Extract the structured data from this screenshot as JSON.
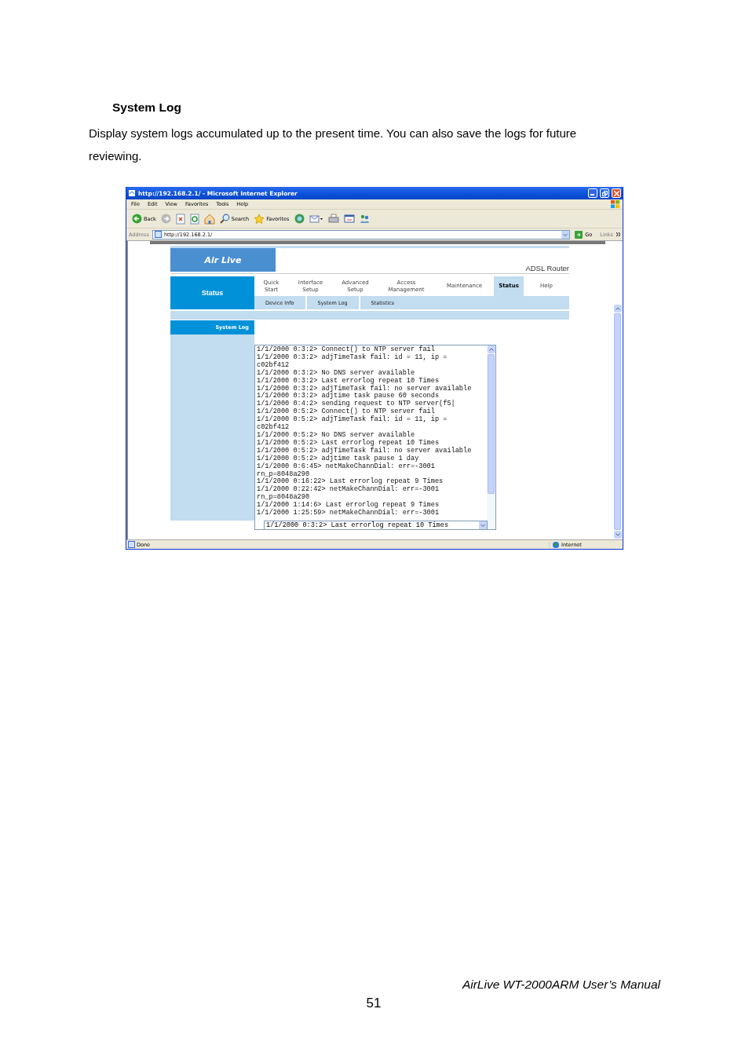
{
  "document": {
    "heading": "System Log",
    "paragraph": "Display system logs accumulated up to the present time. You can also save the logs for future reviewing.",
    "footer": "AirLive WT-2000ARM User’s Manual",
    "page_number": "51"
  },
  "browser": {
    "title": "http://192.168.2.1/ - Microsoft Internet Explorer",
    "menu": [
      "File",
      "Edit",
      "View",
      "Favorites",
      "Tools",
      "Help"
    ],
    "toolbar": [
      {
        "kind": "back",
        "label": "Back"
      },
      {
        "kind": "forward"
      },
      {
        "kind": "stop"
      },
      {
        "kind": "refresh"
      },
      {
        "kind": "home"
      },
      {
        "kind": "search",
        "label": "Search"
      },
      {
        "kind": "favorites",
        "label": "Favorites"
      },
      {
        "kind": "media"
      },
      {
        "kind": "mail"
      },
      {
        "kind": "print"
      },
      {
        "kind": "edit"
      },
      {
        "kind": "messenger"
      }
    ],
    "address": {
      "label": "Address",
      "value": "http://192.168.2.1/",
      "go": "Go",
      "links": "Links"
    },
    "status": {
      "text": "Done",
      "zone": "Internet"
    }
  },
  "router": {
    "logo": "Air Live",
    "product": "ADSL Router",
    "section": "Status",
    "nav": [
      {
        "lines": [
          "Quick",
          "Start"
        ],
        "selected": false
      },
      {
        "lines": [
          "Interface",
          "Setup"
        ],
        "selected": false
      },
      {
        "lines": [
          "Advanced",
          "Setup"
        ],
        "selected": false
      },
      {
        "lines": [
          "Access",
          "Management"
        ],
        "selected": false
      },
      {
        "lines": [
          "Maintenance"
        ],
        "selected": false
      },
      {
        "lines": [
          "Status"
        ],
        "selected": true
      },
      {
        "lines": [
          "Help"
        ],
        "selected": false
      }
    ],
    "subnav": [
      "Device Info",
      "System Log",
      "Statistics"
    ],
    "sidebar": [
      "System Log"
    ],
    "log_lines": [
      "1/1/2000 0:3:2> Connect() to NTP server fail",
      "1/1/2000 0:3:2> adjTimeTask fail: id = 11, ip =",
      "c02bf412",
      "1/1/2000 0:3:2> No DNS server available",
      "1/1/2000 0:3:2> Last errorlog repeat 10 Times",
      "1/1/2000 0:3:2> adjTimeTask fail: no server available",
      "1/1/2000 0:3:2> adjtime task pause 60 seconds",
      "1/1/2000 0:4:2> sending request to NTP server(f5|",
      "1/1/2000 0:5:2> Connect() to NTP server fail",
      "1/1/2000 0:5:2> adjTimeTask fail: id = 11, ip =",
      "c02bf412",
      "1/1/2000 0:5:2> No DNS server available",
      "1/1/2000 0:5:2> Last errorlog repeat 10 Times",
      "1/1/2000 0:5:2> adjTimeTask fail: no server available",
      "1/1/2000 0:5:2> adjtime task pause 1 day",
      "1/1/2000 0:6:45> netMakeChannDial: err=-3001",
      "rn_p=8048a290",
      "1/1/2000 0:16:22> Last errorlog repeat 9 Times",
      "1/1/2000 0:22:42> netMakeChannDial: err=-3001",
      "rn_p=8048a290",
      "1/1/2000 1:14:6> Last errorlog repeat 9 Times",
      "1/1/2000 1:25:59> netMakeChannDial: err=-3001"
    ],
    "log_dropdown": "1/1/2000 0:3:2> Last errorlog repeat 10 Times"
  }
}
